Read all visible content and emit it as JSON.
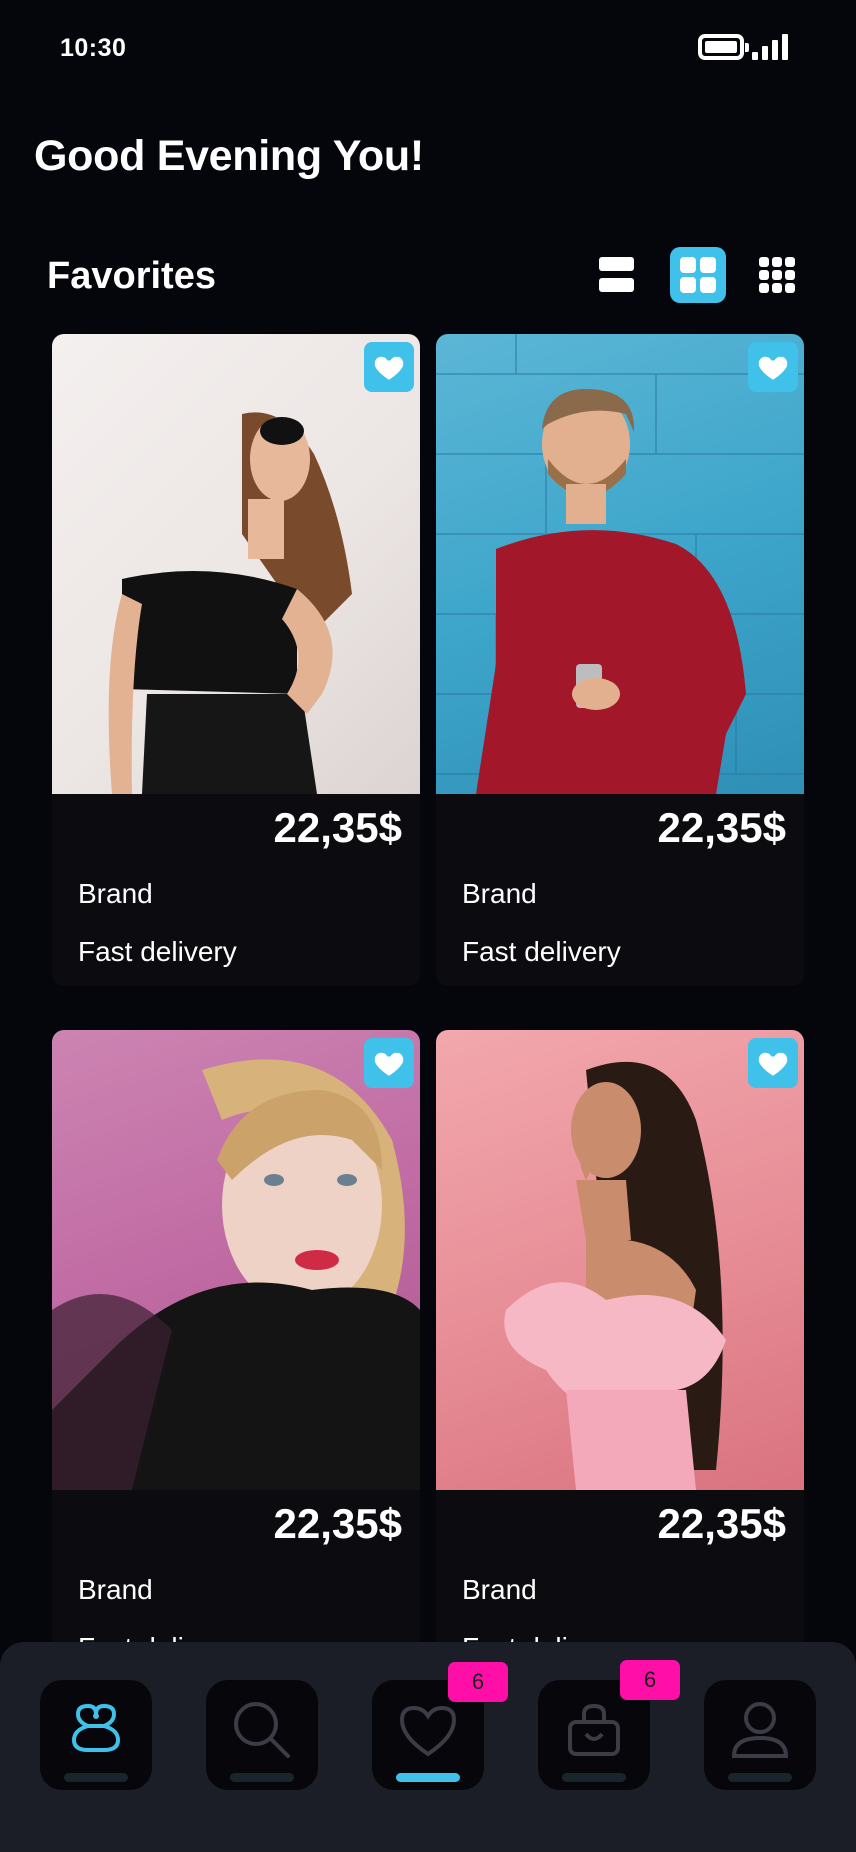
{
  "status": {
    "time": "10:30"
  },
  "header": {
    "greeting": "Good Evening You!"
  },
  "favorites": {
    "title": "Favorites",
    "view_modes": [
      "list",
      "grid",
      "compact-grid"
    ],
    "active_view": "grid",
    "items": [
      {
        "price": "22,35$",
        "brand": "Brand",
        "delivery": "Fast delivery",
        "favorited": true
      },
      {
        "price": "22,35$",
        "brand": "Brand",
        "delivery": "Fast delivery",
        "favorited": true
      },
      {
        "price": "22,35$",
        "brand": "Brand",
        "delivery": "Fast delivery",
        "favorited": true
      },
      {
        "price": "22,35$",
        "brand": "Brand",
        "delivery": "Fast delivery",
        "favorited": true
      }
    ]
  },
  "nav": {
    "items": [
      "logo-icon",
      "search-icon",
      "heart-icon",
      "shopping-bag-icon",
      "profile-icon"
    ],
    "active": "heart-icon",
    "favorites_badge": "6",
    "bag_badge": "6"
  },
  "colors": {
    "accent": "#3fc1e9",
    "badge": "#ff0fa8",
    "background": "#05050c",
    "card": "#0c0c10",
    "nav": "#1b1d27"
  }
}
